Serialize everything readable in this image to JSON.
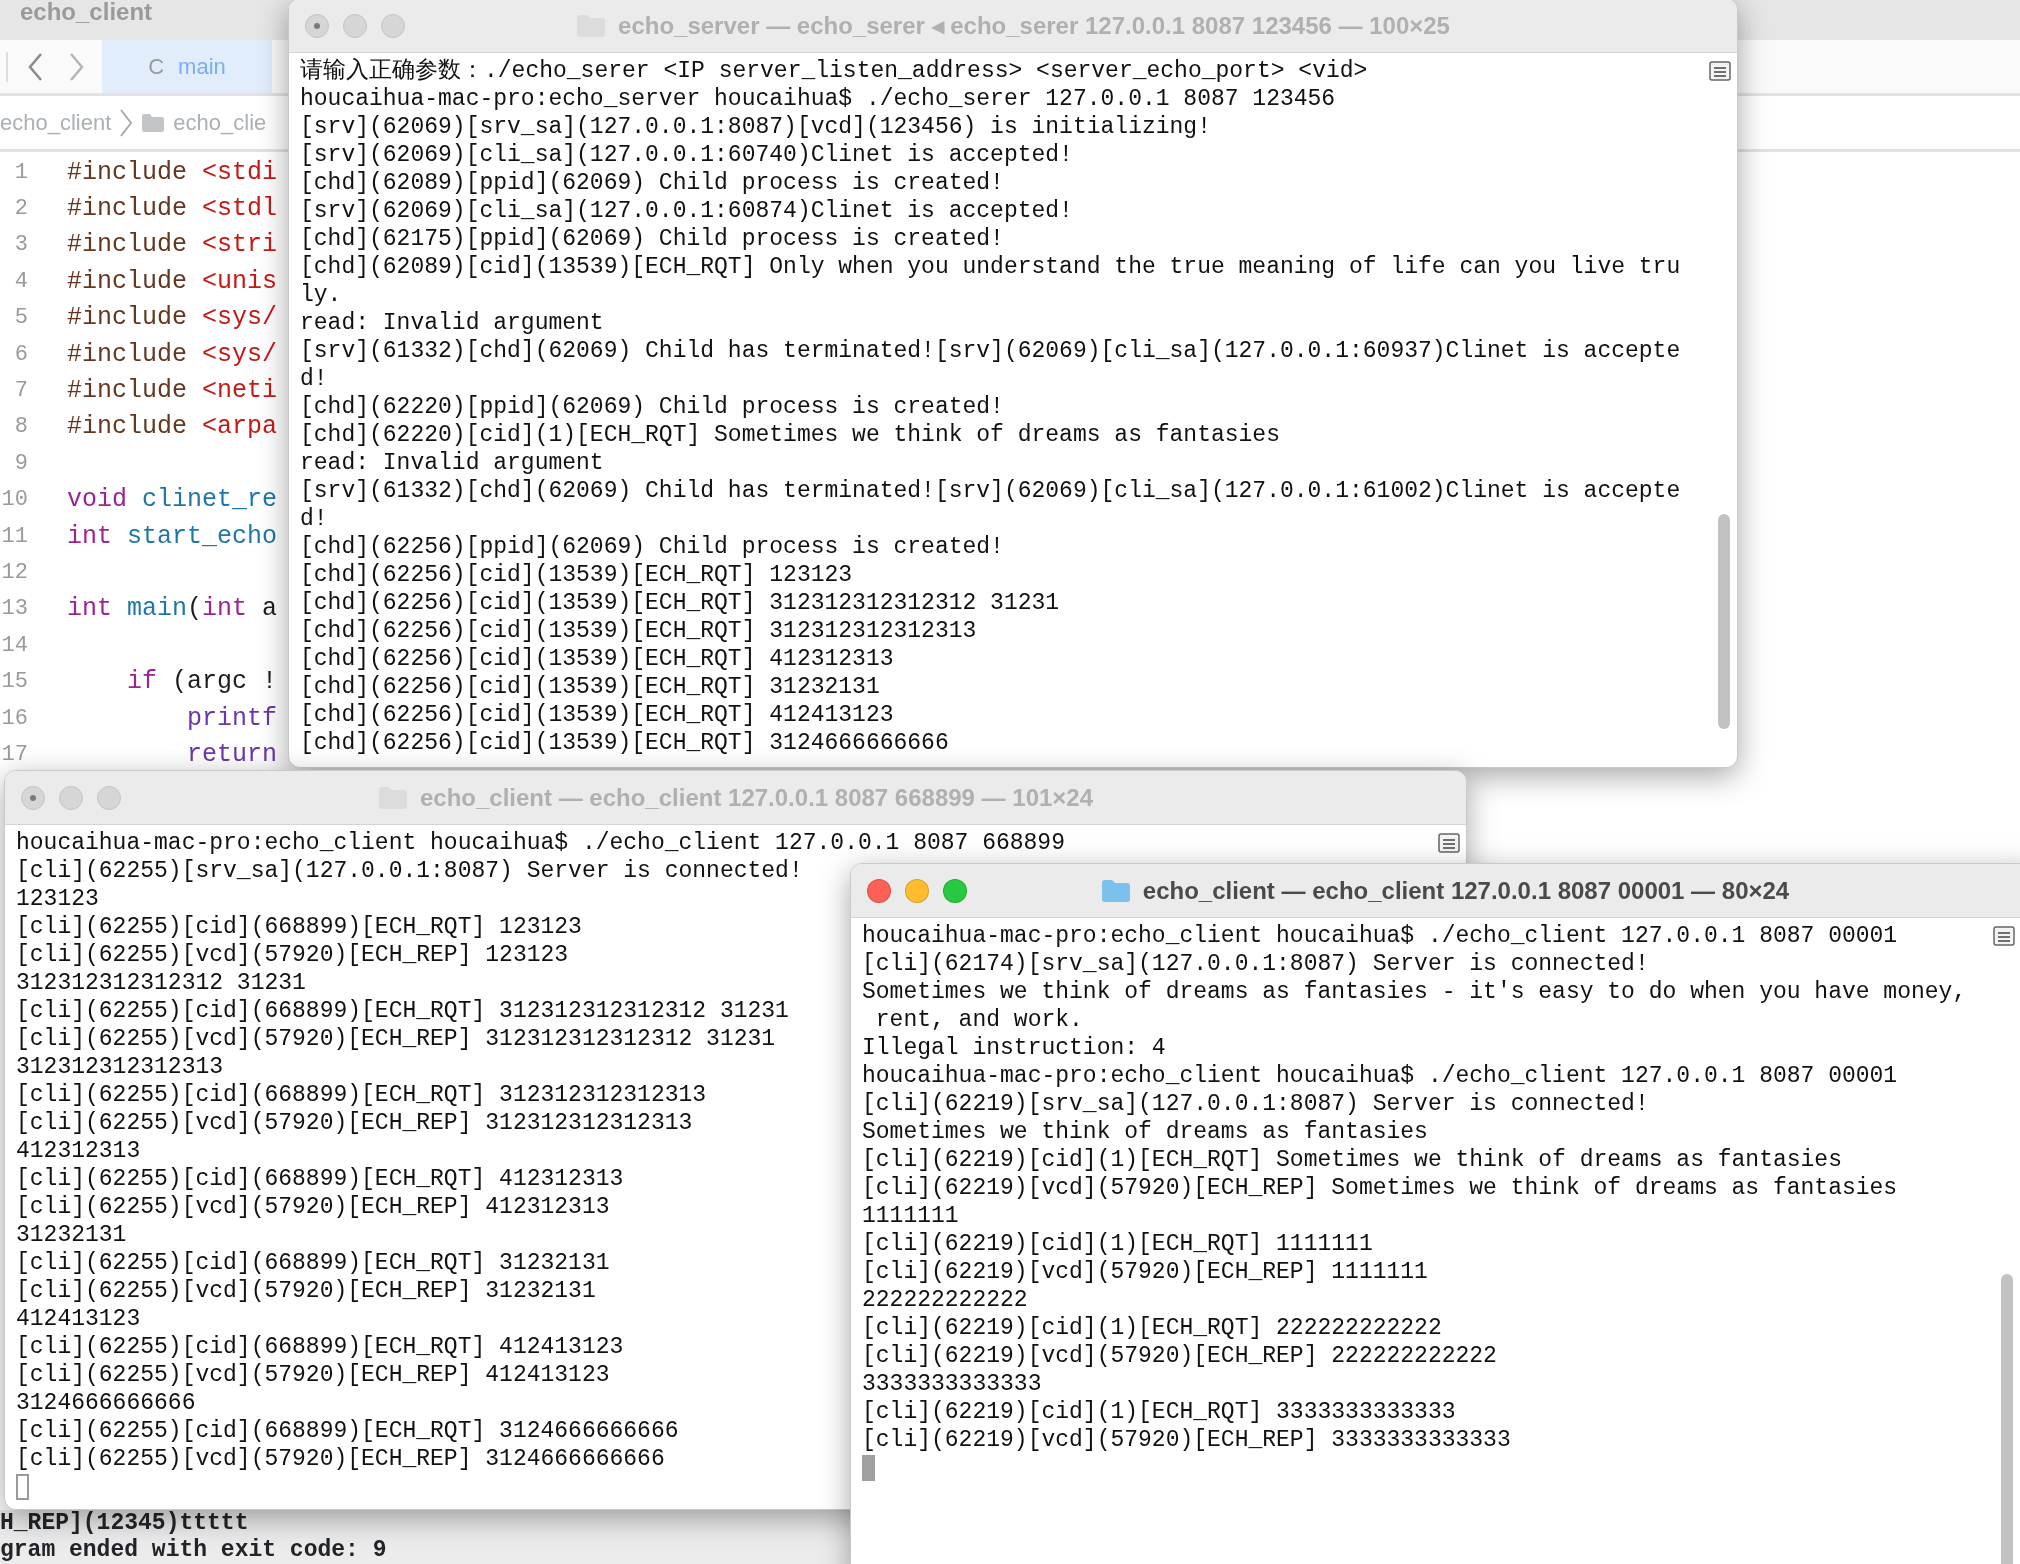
{
  "editor": {
    "title": "echo_client",
    "tabs": [
      {
        "icon": "C",
        "label": "main",
        "selected": true
      }
    ],
    "breadcrumb": [
      "echo_client",
      "echo_clie"
    ],
    "code_lines": [
      {
        "number": "1",
        "tokens": [
          {
            "kind": "directive",
            "text": "#include "
          },
          {
            "kind": "string",
            "text": "<stdi"
          }
        ]
      },
      {
        "number": "2",
        "tokens": [
          {
            "kind": "directive",
            "text": "#include "
          },
          {
            "kind": "string",
            "text": "<stdl"
          }
        ]
      },
      {
        "number": "3",
        "tokens": [
          {
            "kind": "directive",
            "text": "#include "
          },
          {
            "kind": "string",
            "text": "<stri"
          }
        ]
      },
      {
        "number": "4",
        "tokens": [
          {
            "kind": "directive",
            "text": "#include "
          },
          {
            "kind": "string",
            "text": "<unis"
          }
        ]
      },
      {
        "number": "5",
        "tokens": [
          {
            "kind": "directive",
            "text": "#include "
          },
          {
            "kind": "string",
            "text": "<sys/"
          }
        ]
      },
      {
        "number": "6",
        "tokens": [
          {
            "kind": "directive",
            "text": "#include "
          },
          {
            "kind": "string",
            "text": "<sys/"
          }
        ]
      },
      {
        "number": "7",
        "tokens": [
          {
            "kind": "directive",
            "text": "#include "
          },
          {
            "kind": "string",
            "text": "<neti"
          }
        ]
      },
      {
        "number": "8",
        "tokens": [
          {
            "kind": "directive",
            "text": "#include "
          },
          {
            "kind": "string",
            "text": "<arpa"
          }
        ]
      },
      {
        "number": "9"
      },
      {
        "number": "10",
        "tokens": [
          {
            "kind": "keyword",
            "text": "void "
          },
          {
            "kind": "function",
            "text": "clinet_re"
          }
        ]
      },
      {
        "number": "11",
        "tokens": [
          {
            "kind": "keyword",
            "text": "int "
          },
          {
            "kind": "function",
            "text": "start_echo"
          }
        ]
      },
      {
        "number": "12"
      },
      {
        "number": "13",
        "tokens": [
          {
            "kind": "keyword",
            "text": "int "
          },
          {
            "kind": "function",
            "text": "main"
          },
          {
            "kind": "plain",
            "text": "("
          },
          {
            "kind": "keyword",
            "text": "int"
          },
          {
            "kind": "plain",
            "text": " a"
          }
        ],
        "children": [
          {
            "number": "14"
          },
          {
            "number": "15",
            "tokens": [
              {
                "kind": "keyword",
                "text": "if"
              },
              {
                "kind": "plain",
                "text": " (argc !"
              }
            ],
            "children": [
              {
                "number": "16",
                "tokens": [
                  {
                    "kind": "call",
                    "text": "printf"
                  }
                ]
              },
              {
                "number": "17",
                "tokens": [
                  {
                    "kind": "call",
                    "text": "return"
                  }
                ]
              }
            ]
          }
        ]
      }
    ],
    "console": [
      "H_REP](12345)ttttt",
      "gram ended with exit code: 9"
    ]
  },
  "terminals": [
    {
      "title": "echo_server — echo_serer ◂ echo_serer 127.0.0.1 8087 123456 — 100×25",
      "active": false,
      "cursor": false,
      "lines": [
        "请输入正确参数：./echo_serer <IP server_listen_address> <server_echo_port> <vid>",
        "houcaihua-mac-pro:echo_server houcaihua$ ./echo_serer 127.0.0.1 8087 123456",
        "[srv](62069)[srv_sa](127.0.0.1:8087)[vcd](123456) is initializing!",
        "[srv](62069)[cli_sa](127.0.0.1:60740)Clinet is accepted!",
        "[chd](62089)[ppid](62069) Child process is created!",
        "[srv](62069)[cli_sa](127.0.0.1:60874)Clinet is accepted!",
        "[chd](62175)[ppid](62069) Child process is created!",
        "[chd](62089)[cid](13539)[ECH_RQT] Only when you understand the true meaning of life can you live tru",
        "ly.",
        "read: Invalid argument",
        "[srv](61332)[chd](62069) Child has terminated![srv](62069)[cli_sa](127.0.0.1:60937)Clinet is accepte",
        "d!",
        "[chd](62220)[ppid](62069) Child process is created!",
        "[chd](62220)[cid](1)[ECH_RQT] Sometimes we think of dreams as fantasies",
        "read: Invalid argument",
        "[srv](61332)[chd](62069) Child has terminated![srv](62069)[cli_sa](127.0.0.1:61002)Clinet is accepte",
        "d!",
        "[chd](62256)[ppid](62069) Child process is created!",
        "[chd](62256)[cid](13539)[ECH_RQT] 123123",
        "[chd](62256)[cid](13539)[ECH_RQT] 312312312312312 31231",
        "[chd](62256)[cid](13539)[ECH_RQT] 312312312312313",
        "[chd](62256)[cid](13539)[ECH_RQT] 412312313",
        "[chd](62256)[cid](13539)[ECH_RQT] 31232131",
        "[chd](62256)[cid](13539)[ECH_RQT] 412413123",
        "[chd](62256)[cid](13539)[ECH_RQT] 3124666666666"
      ]
    },
    {
      "title": "echo_client — echo_client 127.0.0.1 8087 668899 — 101×24",
      "active": false,
      "cursor": true,
      "lines": [
        "houcaihua-mac-pro:echo_client houcaihua$ ./echo_client 127.0.0.1 8087 668899",
        "[cli](62255)[srv_sa](127.0.0.1:8087) Server is connected!",
        "123123",
        "[cli](62255)[cid](668899)[ECH_RQT] 123123",
        "[cli](62255)[vcd](57920)[ECH_REP] 123123",
        "312312312312312 31231",
        "[cli](62255)[cid](668899)[ECH_RQT] 312312312312312 31231",
        "[cli](62255)[vcd](57920)[ECH_REP] 312312312312312 31231",
        "312312312312313",
        "[cli](62255)[cid](668899)[ECH_RQT] 312312312312313",
        "[cli](62255)[vcd](57920)[ECH_REP] 312312312312313",
        "412312313",
        "[cli](62255)[cid](668899)[ECH_RQT] 412312313",
        "[cli](62255)[vcd](57920)[ECH_REP] 412312313",
        "31232131",
        "[cli](62255)[cid](668899)[ECH_RQT] 31232131",
        "[cli](62255)[vcd](57920)[ECH_REP] 31232131",
        "412413123",
        "[cli](62255)[cid](668899)[ECH_RQT] 412413123",
        "[cli](62255)[vcd](57920)[ECH_REP] 412413123",
        "3124666666666",
        "[cli](62255)[cid](668899)[ECH_RQT] 3124666666666",
        "[cli](62255)[vcd](57920)[ECH_REP] 3124666666666"
      ]
    },
    {
      "title": "echo_client — echo_client 127.0.0.1 8087 00001 — 80×24",
      "active": true,
      "cursor": true,
      "lines": [
        "houcaihua-mac-pro:echo_client houcaihua$ ./echo_client 127.0.0.1 8087 00001",
        "[cli](62174)[srv_sa](127.0.0.1:8087) Server is connected!",
        "Sometimes we think of dreams as fantasies - it's easy to do when you have money,",
        " rent, and work.",
        "Illegal instruction: 4",
        "houcaihua-mac-pro:echo_client houcaihua$ ./echo_client 127.0.0.1 8087 00001",
        "[cli](62219)[srv_sa](127.0.0.1:8087) Server is connected!",
        "Sometimes we think of dreams as fantasies",
        "[cli](62219)[cid](1)[ECH_RQT] Sometimes we think of dreams as fantasies",
        "[cli](62219)[vcd](57920)[ECH_REP] Sometimes we think of dreams as fantasies",
        "1111111",
        "[cli](62219)[cid](1)[ECH_RQT] 1111111",
        "[cli](62219)[vcd](57920)[ECH_REP] 1111111",
        "222222222222",
        "[cli](62219)[cid](1)[ECH_RQT] 222222222222",
        "[cli](62219)[vcd](57920)[ECH_REP] 222222222222",
        "3333333333333",
        "[cli](62219)[cid](1)[ECH_RQT] 3333333333333",
        "[cli](62219)[vcd](57920)[ECH_REP] 3333333333333"
      ]
    }
  ]
}
